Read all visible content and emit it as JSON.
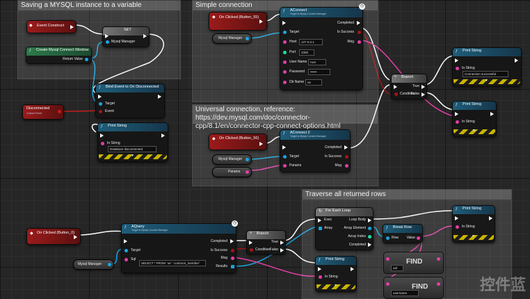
{
  "comments": {
    "save_instance": "Saving a MYSQL instance to a variable",
    "simple_connection": "Simple connection",
    "universal_connection": "Universal connection, reference: https://dev.mysql.com/doc/connector-cpp/8.1/en/connector-cpp-connect-options.html",
    "traverse": "Traverse all returned rows"
  },
  "nodes": {
    "event_construct": {
      "title": "Event Construct"
    },
    "set_node": {
      "title": "SET",
      "pin_mysql": "Mysql Manager"
    },
    "create_widget": {
      "title": "Create Mysql Connect Window",
      "return": "Return Value"
    },
    "bind_event": {
      "title": "Bind Event to On Disconnected",
      "pin_target": "Target",
      "pin_event": "Event"
    },
    "disconnected_event": {
      "title": "Disconnected",
      "sub": "Custom Event"
    },
    "print_string_1": {
      "title": "Print String",
      "in_string": "In String",
      "value": "Database disconnected"
    },
    "on_clicked_b5": {
      "title": "On Clicked (Button_55)"
    },
    "mysql_manager_1": {
      "title": "Mysql Manager"
    },
    "aconnect": {
      "title": "AConnect",
      "sub": "Target is Mysql Connect Manager",
      "target": "Target",
      "host_label": "Host",
      "host_value": "127.0.0.1",
      "port_label": "Port",
      "port_value": "3306",
      "user_label": "User Name",
      "user_value": "root",
      "password_label": "Password",
      "password_value": "••••••",
      "db_label": "Db Name",
      "db_value": "ue",
      "completed": "Completed",
      "is_success": "Is Success",
      "msg": "Msg"
    },
    "branch_1": {
      "title": "Branch",
      "condition": "Condition",
      "true_label": "True",
      "false_label": "False"
    },
    "print_string_2": {
      "title": "Print String",
      "in_string": "In String",
      "value": "Connection successful"
    },
    "print_string_3": {
      "title": "Print String",
      "in_string": "In String"
    },
    "on_clicked_b6": {
      "title": "On Clicked (Button_56)"
    },
    "mysql_manager_2": {
      "title": "Mysql Manager"
    },
    "params": {
      "title": "Params"
    },
    "aconnect2": {
      "title": "AConnect 2",
      "sub": "Target is Mysql Connect Manager",
      "target": "Target",
      "params": "Params",
      "completed": "Completed",
      "is_success": "Is Success",
      "msg": "Msg"
    },
    "on_clicked_b0": {
      "title": "On Clicked (Button_0)"
    },
    "mysql_manager_3": {
      "title": "Mysql Manager"
    },
    "aquery": {
      "title": "AQuery",
      "sub": "Target is Mysql Connect Manager",
      "target": "Target",
      "sql_label": "Sql",
      "sql_value": "SELECT * FROM `ue`.`common_member`",
      "completed": "Completed",
      "is_success": "Is Success",
      "msg": "Msg",
      "results": "Results"
    },
    "branch_2": {
      "title": "Branch",
      "condition": "Condition",
      "true_label": "True",
      "false_label": "False"
    },
    "foreach": {
      "title": "For Each Loop",
      "exec": "Exec",
      "array": "Array",
      "loop_body": "Loop Body",
      "array_element": "Array Element",
      "array_index": "Array Index",
      "completed": "Completed"
    },
    "break_row": {
      "title": "Break Row",
      "row": "Row",
      "value": "Value"
    },
    "print_string_4": {
      "title": "Print String",
      "in_string": "In String"
    },
    "print_string_5": {
      "title": "Print String",
      "in_string": "In String"
    },
    "find_1": {
      "label": "FIND",
      "key": "uid"
    },
    "find_2": {
      "label": "FIND",
      "key": "username"
    }
  },
  "watermark": "控件蓝",
  "colors": {
    "exec": "#ffffff",
    "object": "#1aa6e0",
    "string": "#e43ea8",
    "bool": "#a31515",
    "event_header": "#9b1b1b",
    "function_header": "#1f5d7a"
  }
}
